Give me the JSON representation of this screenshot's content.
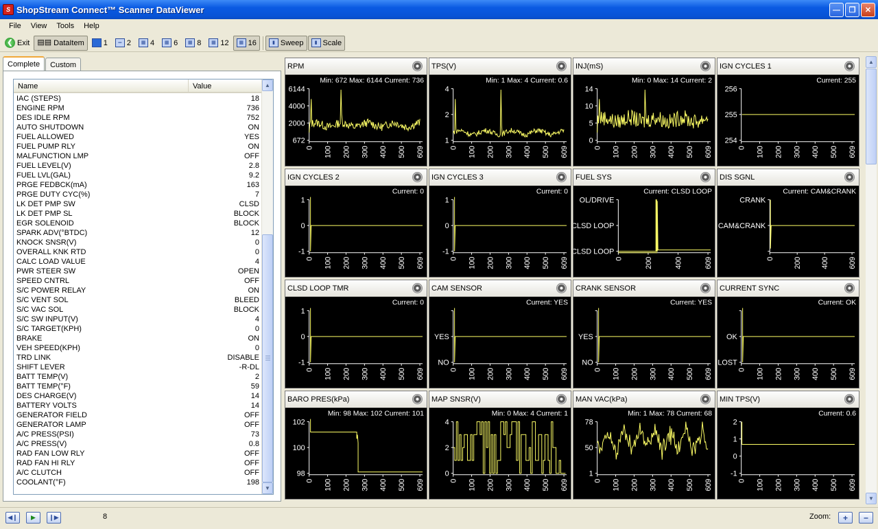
{
  "window": {
    "title": "ShopStream Connect™ Scanner DataViewer",
    "icon_label": "S"
  },
  "menu": [
    "File",
    "View",
    "Tools",
    "Help"
  ],
  "toolbar": {
    "exit_label": "Exit",
    "dataitem_label": "DataItem",
    "layouts": [
      "1",
      "2",
      "4",
      "6",
      "8",
      "12",
      "16"
    ],
    "sweep_label": "Sweep",
    "scale_label": "Scale"
  },
  "tabs": {
    "complete": "Complete",
    "custom": "Custom"
  },
  "list": {
    "header_name": "Name",
    "header_value": "Value",
    "rows": [
      {
        "name": "IAC (STEPS)",
        "value": "18"
      },
      {
        "name": "ENGINE RPM",
        "value": "736"
      },
      {
        "name": "DES IDLE RPM",
        "value": "752"
      },
      {
        "name": "AUTO SHUTDOWN",
        "value": "ON"
      },
      {
        "name": "FUEL ALLOWED",
        "value": "YES"
      },
      {
        "name": "FUEL PUMP RLY",
        "value": "ON"
      },
      {
        "name": "MALFUNCTION LMP",
        "value": "OFF"
      },
      {
        "name": "FUEL LEVEL(V)",
        "value": "2.8"
      },
      {
        "name": "FUEL LVL(GAL)",
        "value": "9.2"
      },
      {
        "name": "PRGE FEDBCK(mA)",
        "value": "163"
      },
      {
        "name": "PRGE DUTY CYC(%)",
        "value": "7"
      },
      {
        "name": "LK DET PMP SW",
        "value": "CLSD"
      },
      {
        "name": "LK DET PMP SL",
        "value": "BLOCK"
      },
      {
        "name": "EGR SOLENOID",
        "value": "BLOCK"
      },
      {
        "name": "SPARK ADV(°BTDC)",
        "value": "12"
      },
      {
        "name": "KNOCK SNSR(V)",
        "value": "0"
      },
      {
        "name": "OVERALL KNK RTD",
        "value": "0"
      },
      {
        "name": "CALC LOAD VALUE",
        "value": "4"
      },
      {
        "name": "PWR STEER SW",
        "value": "OPEN"
      },
      {
        "name": "SPEED CNTRL",
        "value": "OFF"
      },
      {
        "name": "S/C POWER RELAY",
        "value": "ON"
      },
      {
        "name": "S/C VENT SOL",
        "value": "BLEED"
      },
      {
        "name": "S/C VAC SOL",
        "value": "BLOCK"
      },
      {
        "name": "S/C SW INPUT(V)",
        "value": "4"
      },
      {
        "name": "S/C TARGET(KPH)",
        "value": "0"
      },
      {
        "name": "BRAKE",
        "value": "ON"
      },
      {
        "name": "VEH SPEED(KPH)",
        "value": "0"
      },
      {
        "name": "TRD LINK",
        "value": "DISABLE"
      },
      {
        "name": "SHIFT LEVER",
        "value": "-R-DL"
      },
      {
        "name": "BATT TEMP(V)",
        "value": "2"
      },
      {
        "name": "BATT TEMP(°F)",
        "value": "59"
      },
      {
        "name": "DES CHARGE(V)",
        "value": "14"
      },
      {
        "name": "BATTERY VOLTS",
        "value": "14"
      },
      {
        "name": "GENERATOR FIELD",
        "value": "OFF"
      },
      {
        "name": "GENERATOR LAMP",
        "value": "OFF"
      },
      {
        "name": "A/C PRESS(PSI)",
        "value": "73"
      },
      {
        "name": "A/C PRESS(V)",
        "value": "0.8"
      },
      {
        "name": "RAD FAN LOW RLY",
        "value": "OFF"
      },
      {
        "name": "RAD FAN HI RLY",
        "value": "OFF"
      },
      {
        "name": "A/C CLUTCH",
        "value": "OFF"
      },
      {
        "name": "COOLANT(°F)",
        "value": "198"
      }
    ]
  },
  "plot_style": {
    "background": "#000000",
    "trace": "#ffff66",
    "axis": "#ffffff",
    "text": "#ffffff"
  },
  "graphs": [
    {
      "title": "RPM",
      "info": "Min: 672    Max: 6144    Current: 736",
      "yticks": [
        "6144",
        "4000",
        "2000",
        "672"
      ],
      "xticks": [
        "0",
        "100",
        "200",
        "300",
        "400",
        "500",
        "609"
      ],
      "kind": "rpm"
    },
    {
      "title": "TPS(V)",
      "info": "Min: 1     Max: 4     Current: 0.6",
      "yticks": [
        "4",
        "2",
        "1"
      ],
      "xticks": [
        "0",
        "100",
        "200",
        "300",
        "400",
        "500",
        "609"
      ],
      "kind": "tps"
    },
    {
      "title": "INJ(mS)",
      "info": "Min: 0     Max: 14     Current: 2",
      "yticks": [
        "14",
        "10",
        "5",
        "0"
      ],
      "xticks": [
        "0",
        "100",
        "200",
        "300",
        "400",
        "500",
        "609"
      ],
      "kind": "inj"
    },
    {
      "title": "IGN CYCLES 1",
      "info": "Current: 255",
      "yticks": [
        "256",
        "255",
        "254"
      ],
      "xticks": [
        "0",
        "100",
        "200",
        "300",
        "400",
        "500",
        "609"
      ],
      "kind": "flat"
    },
    {
      "title": "IGN CYCLES 2",
      "info": "Current: 0",
      "yticks": [
        "1",
        "0",
        "-1"
      ],
      "xticks": [
        "0",
        "100",
        "200",
        "300",
        "400",
        "500",
        "609"
      ],
      "kind": "flat-spike"
    },
    {
      "title": "IGN CYCLES 3",
      "info": "Current: 0",
      "yticks": [
        "1",
        "0",
        "-1"
      ],
      "xticks": [
        "0",
        "100",
        "200",
        "300",
        "400",
        "500",
        "609"
      ],
      "kind": "flat-spike"
    },
    {
      "title": "FUEL SYS",
      "info": "Current: CLSD LOOP",
      "yticks": [
        "OL/DRIVE",
        "CLSD LOOP",
        "CLSD LOOP"
      ],
      "xticks": [
        "0",
        "200",
        "400",
        "609"
      ],
      "kind": "fuelsys"
    },
    {
      "title": "DIS SGNL",
      "info": "Current: CAM&CRANK",
      "yticks": [
        "CRANK",
        "CAM&CRANK",
        ""
      ],
      "xticks": [
        "0",
        "200",
        "400",
        "609"
      ],
      "kind": "dis"
    },
    {
      "title": "CLSD LOOP TMR",
      "info": "Current: 0",
      "yticks": [
        "1",
        "0",
        "-1"
      ],
      "xticks": [
        "0",
        "100",
        "200",
        "300",
        "400",
        "500",
        "609"
      ],
      "kind": "flat-spike"
    },
    {
      "title": "CAM SENSOR",
      "info": "Current: YES",
      "yticks": [
        "",
        "YES",
        "NO"
      ],
      "xticks": [
        "0",
        "100",
        "200",
        "300",
        "400",
        "500",
        "609"
      ],
      "kind": "flat-spike"
    },
    {
      "title": "CRANK SENSOR",
      "info": "Current: YES",
      "yticks": [
        "",
        "YES",
        "NO"
      ],
      "xticks": [
        "0",
        "100",
        "200",
        "300",
        "400",
        "500",
        "609"
      ],
      "kind": "flat-spike"
    },
    {
      "title": "CURRENT SYNC",
      "info": "Current: OK",
      "yticks": [
        "",
        "OK",
        "LOST"
      ],
      "xticks": [
        "0",
        "100",
        "200",
        "300",
        "400",
        "500",
        "609"
      ],
      "kind": "flat-spike"
    },
    {
      "title": "BARO PRES(kPa)",
      "info": "Min: 98     Max: 102     Current: 101",
      "yticks": [
        "102",
        "100",
        "98"
      ],
      "xticks": [
        "0",
        "100",
        "200",
        "300",
        "400",
        "500",
        "609"
      ],
      "kind": "baro"
    },
    {
      "title": "MAP SNSR(V)",
      "info": "Min: 0     Max: 4     Current: 1",
      "yticks": [
        "4",
        "2",
        "0"
      ],
      "xticks": [
        "0",
        "100",
        "200",
        "300",
        "400",
        "500",
        "609"
      ],
      "kind": "map"
    },
    {
      "title": "MAN VAC(kPa)",
      "info": "Min: 1     Max: 78     Current: 68",
      "yticks": [
        "78",
        "50",
        "1"
      ],
      "xticks": [
        "0",
        "100",
        "200",
        "300",
        "400",
        "500",
        "609"
      ],
      "kind": "vac"
    },
    {
      "title": "MIN TPS(V)",
      "info": "Current: 0.6",
      "yticks": [
        "2",
        "1",
        "0",
        "-1"
      ],
      "xticks": [
        "0",
        "100",
        "200",
        "300",
        "400",
        "500",
        "609"
      ],
      "kind": "mintps"
    }
  ],
  "status": {
    "frame": "8",
    "zoom_label": "Zoom:"
  }
}
